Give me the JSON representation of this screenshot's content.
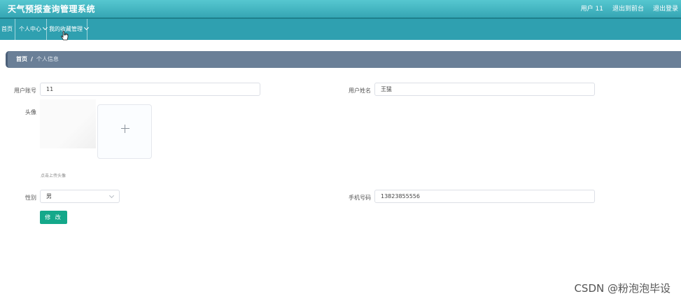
{
  "header": {
    "title": "天气预报查询管理系统",
    "links": [
      "用户 11",
      "退出到前台",
      "退出登录"
    ]
  },
  "nav": {
    "items": [
      {
        "label": "首页",
        "has_dropdown": false
      },
      {
        "label": "个人中心",
        "has_dropdown": true
      },
      {
        "label": "我的收藏管理",
        "has_dropdown": true
      }
    ]
  },
  "breadcrumb": {
    "home": "首页",
    "separator": "/",
    "current": "个人信息"
  },
  "form": {
    "account_label": "用户账号",
    "account_value": "11",
    "name_label": "用户姓名",
    "name_value": "王猛",
    "avatar_label": "头像",
    "avatar_hint": "点击上传头像",
    "gender_label": "性别",
    "gender_value": "男",
    "phone_label": "手机号码",
    "phone_value": "13823855556",
    "submit_label": "修 改"
  },
  "watermark": "CSDN @粉泡泡毕设",
  "colors": {
    "header": "#35a6b4",
    "navbar": "#2fa0b0",
    "breadcrumb": "#6a7f97",
    "button": "#14a88a"
  }
}
